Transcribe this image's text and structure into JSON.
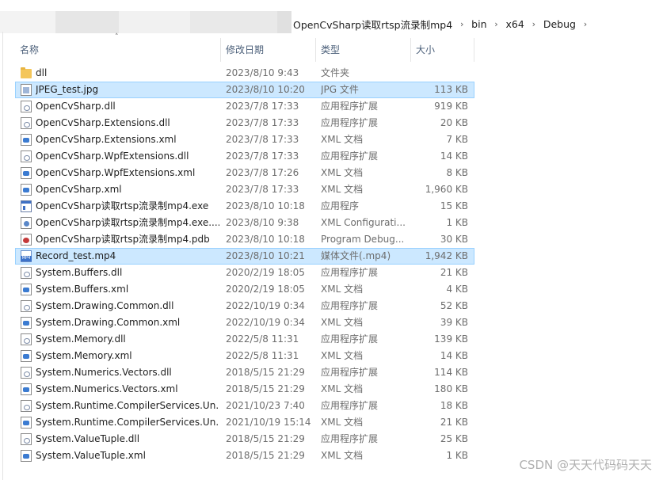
{
  "breadcrumb": [
    "OpenCvSharp读取rtsp流录制mp4",
    "bin",
    "x64",
    "Debug"
  ],
  "columns": {
    "name": "名称",
    "date": "修改日期",
    "type": "类型",
    "size": "大小"
  },
  "files": [
    {
      "name": "dll",
      "date": "2023/8/10 9:43",
      "type": "文件夹",
      "size": "",
      "icon": "folder-icon",
      "selected": false
    },
    {
      "name": "JPEG_test.jpg",
      "date": "2023/8/10 10:20",
      "type": "JPG 文件",
      "size": "113 KB",
      "icon": "jpg-icon",
      "selected": true
    },
    {
      "name": "OpenCvSharp.dll",
      "date": "2023/7/8 17:33",
      "type": "应用程序扩展",
      "size": "919 KB",
      "icon": "dll-icon",
      "selected": false
    },
    {
      "name": "OpenCvSharp.Extensions.dll",
      "date": "2023/7/8 17:33",
      "type": "应用程序扩展",
      "size": "20 KB",
      "icon": "dll-icon",
      "selected": false
    },
    {
      "name": "OpenCvSharp.Extensions.xml",
      "date": "2023/7/8 17:33",
      "type": "XML 文档",
      "size": "7 KB",
      "icon": "xml-icon",
      "selected": false
    },
    {
      "name": "OpenCvSharp.WpfExtensions.dll",
      "date": "2023/7/8 17:33",
      "type": "应用程序扩展",
      "size": "14 KB",
      "icon": "dll-icon",
      "selected": false
    },
    {
      "name": "OpenCvSharp.WpfExtensions.xml",
      "date": "2023/7/8 17:26",
      "type": "XML 文档",
      "size": "8 KB",
      "icon": "xml-icon",
      "selected": false
    },
    {
      "name": "OpenCvSharp.xml",
      "date": "2023/7/8 17:33",
      "type": "XML 文档",
      "size": "1,960 KB",
      "icon": "xml-icon",
      "selected": false
    },
    {
      "name": "OpenCvSharp读取rtsp流录制mp4.exe",
      "date": "2023/8/10 10:18",
      "type": "应用程序",
      "size": "15 KB",
      "icon": "exe-icon",
      "selected": false
    },
    {
      "name": "OpenCvSharp读取rtsp流录制mp4.exe....",
      "date": "2023/8/10 9:38",
      "type": "XML Configurati...",
      "size": "1 KB",
      "icon": "config-icon",
      "selected": false
    },
    {
      "name": "OpenCvSharp读取rtsp流录制mp4.pdb",
      "date": "2023/8/10 10:18",
      "type": "Program Debug...",
      "size": "30 KB",
      "icon": "pdb-icon",
      "selected": false
    },
    {
      "name": "Record_test.mp4",
      "date": "2023/8/10 10:21",
      "type": "媒体文件(.mp4)",
      "size": "1,942 KB",
      "icon": "mp4-icon",
      "selected": true
    },
    {
      "name": "System.Buffers.dll",
      "date": "2020/2/19 18:05",
      "type": "应用程序扩展",
      "size": "21 KB",
      "icon": "dll-icon",
      "selected": false
    },
    {
      "name": "System.Buffers.xml",
      "date": "2020/2/19 18:05",
      "type": "XML 文档",
      "size": "4 KB",
      "icon": "xml-icon",
      "selected": false
    },
    {
      "name": "System.Drawing.Common.dll",
      "date": "2022/10/19 0:34",
      "type": "应用程序扩展",
      "size": "52 KB",
      "icon": "dll-icon",
      "selected": false
    },
    {
      "name": "System.Drawing.Common.xml",
      "date": "2022/10/19 0:34",
      "type": "XML 文档",
      "size": "39 KB",
      "icon": "xml-icon",
      "selected": false
    },
    {
      "name": "System.Memory.dll",
      "date": "2022/5/8 11:31",
      "type": "应用程序扩展",
      "size": "139 KB",
      "icon": "dll-icon",
      "selected": false
    },
    {
      "name": "System.Memory.xml",
      "date": "2022/5/8 11:31",
      "type": "XML 文档",
      "size": "14 KB",
      "icon": "xml-icon",
      "selected": false
    },
    {
      "name": "System.Numerics.Vectors.dll",
      "date": "2018/5/15 21:29",
      "type": "应用程序扩展",
      "size": "114 KB",
      "icon": "dll-icon",
      "selected": false
    },
    {
      "name": "System.Numerics.Vectors.xml",
      "date": "2018/5/15 21:29",
      "type": "XML 文档",
      "size": "180 KB",
      "icon": "xml-icon",
      "selected": false
    },
    {
      "name": "System.Runtime.CompilerServices.Un...",
      "date": "2021/10/23 7:40",
      "type": "应用程序扩展",
      "size": "18 KB",
      "icon": "dll-icon",
      "selected": false
    },
    {
      "name": "System.Runtime.CompilerServices.Un...",
      "date": "2021/10/19 15:14",
      "type": "XML 文档",
      "size": "21 KB",
      "icon": "xml-icon",
      "selected": false
    },
    {
      "name": "System.ValueTuple.dll",
      "date": "2018/5/15 21:29",
      "type": "应用程序扩展",
      "size": "25 KB",
      "icon": "dll-icon",
      "selected": false
    },
    {
      "name": "System.ValueTuple.xml",
      "date": "2018/5/15 21:29",
      "type": "XML 文档",
      "size": "1 KB",
      "icon": "xml-icon",
      "selected": false
    }
  ],
  "watermark": "CSDN @天天代码码天天"
}
